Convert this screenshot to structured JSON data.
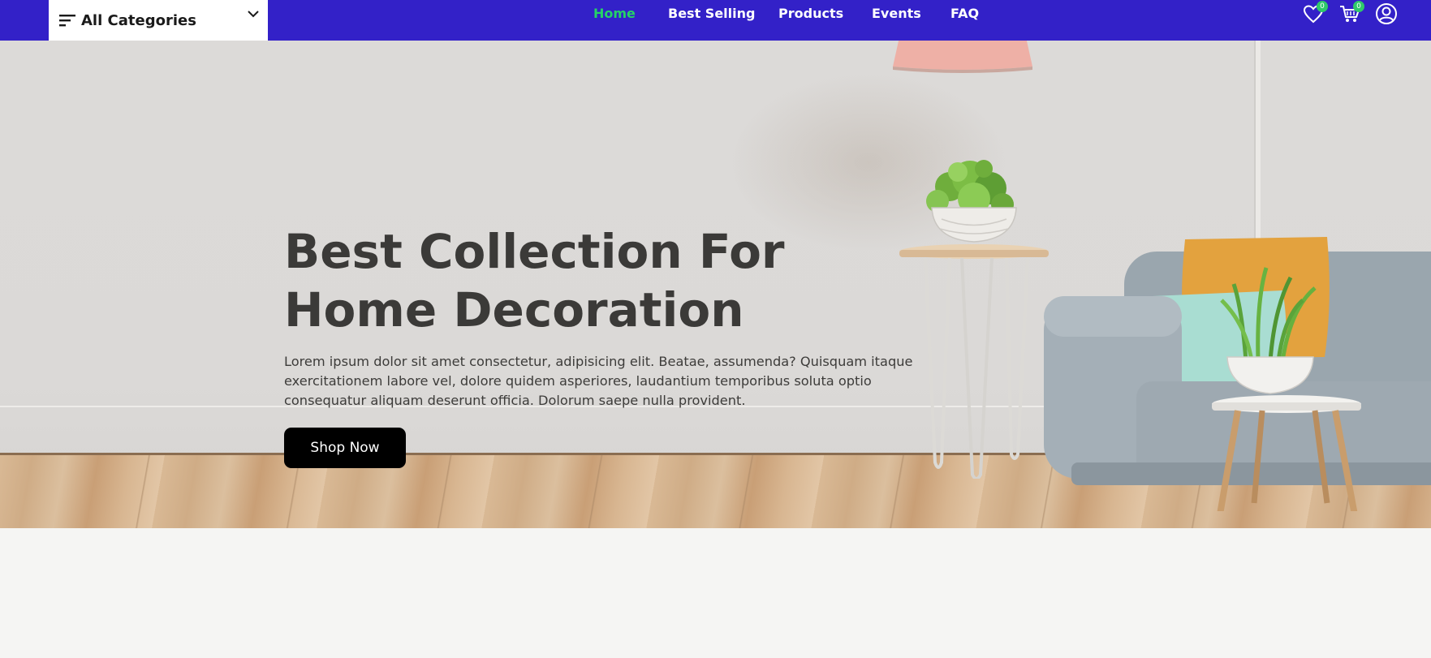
{
  "nav": {
    "categories_label": "All Categories",
    "links": [
      "Home",
      "Best Selling",
      "Products",
      "Events",
      "FAQ"
    ],
    "active_link": "Home",
    "wishlist_count": "0",
    "cart_count": "0",
    "icons": [
      "menu-icon",
      "chevron-down-icon",
      "heart-icon",
      "cart-icon",
      "user-icon"
    ],
    "colors": {
      "bar": "#3321c8",
      "active": "#25d366",
      "badge": "#2fc96a"
    }
  },
  "hero": {
    "title_line1": "Best Collection For",
    "title_line2": "Home Decoration",
    "description": "Lorem ipsum dolor sit amet consectetur, adipisicing elit. Beatae, assumenda? Quisquam itaque exercitationem labore vel, dolore quidem asperiores, laudantium temporibus soluta optio consequatur aliquam deserunt officia. Dolorum saepe nulla provident.",
    "cta_label": "Shop Now"
  }
}
